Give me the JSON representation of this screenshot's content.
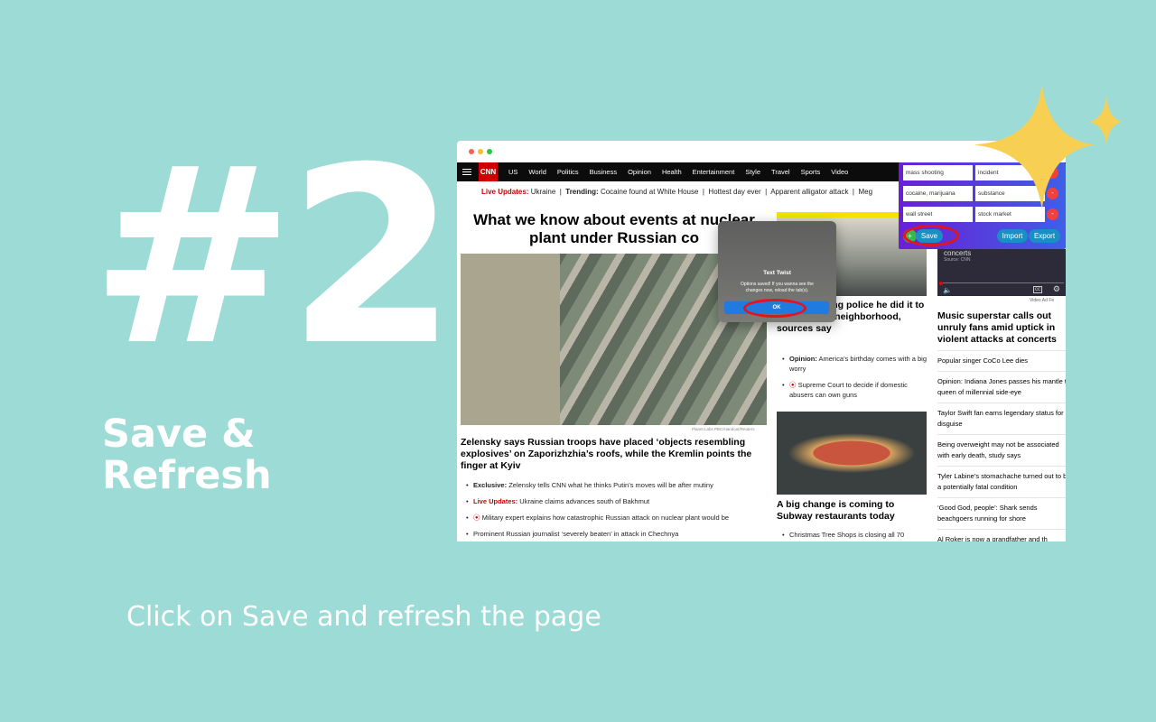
{
  "slide": {
    "number": "#2",
    "title": "Save & Refresh",
    "caption": "Click on Save and refresh the page"
  },
  "colors": {
    "background": "#9ddcd6",
    "cnn_red": "#cc0000",
    "extension_gradient": [
      "#6a1fd6",
      "#3f5fe6"
    ],
    "star": "#f7cf52",
    "highlight_ring": "#e4141b"
  },
  "nav": {
    "logo": "CNN",
    "items": [
      "US",
      "World",
      "Politics",
      "Business",
      "Opinion",
      "Health",
      "Entertainment",
      "Style",
      "Travel",
      "Sports",
      "Video"
    ]
  },
  "trending": {
    "live_label": "Live Updates:",
    "live_text": "Ukraine",
    "trending_label": "Trending:",
    "items": [
      "Cocaine found at White House",
      "Hottest day ever",
      "Apparent alligator attack",
      "Meg"
    ]
  },
  "main": {
    "headline": "What we know about events at nuclear plant under Russian co",
    "image_credit": "Planet Labs PBC/Handout/Reuters",
    "story": "Zelensky says Russian troops have placed ‘objects resembling explosives’ on Zaporizhzhia’s roofs, while the Kremlin points the finger at Kyiv",
    "bullets": [
      {
        "label": "Exclusive:",
        "text": "Zelensky tells CNN what he thinks Putin’s moves will be after mutiny"
      },
      {
        "label": "Live Updates:",
        "text": "Ukraine claims advances south of Bakhmut"
      },
      {
        "text": "Military expert explains how catastrophic Russian attack on nuclear plant would be"
      },
      {
        "text": "Prominent Russian journalist ‘severely beaten’ in attack in Chechnya"
      }
    ]
  },
  "middle": {
    "headline": "mass shooting police he did it to clean up the neighborhood, sources say",
    "bullets": [
      {
        "label": "Opinion:",
        "text": "America’s birthday comes with a big worry"
      },
      {
        "text": "Supreme Court to decide if domestic abusers can own guns"
      }
    ],
    "story2": "A big change is coming to Subway restaurants today",
    "bullets2": [
      "Christmas Tree Shops is closing all 70"
    ]
  },
  "right": {
    "video_title": "concerts",
    "video_source": "Source: CNN",
    "ad_feedback": "Video Ad Fe",
    "headline": "Music superstar calls out unruly fans amid uptick in violent attacks at concerts",
    "list": [
      "Popular singer CoCo Lee dies",
      "Opinion: Indiana Jones passes his mantle to queen of millennial side-eye",
      "Taylor Swift fan earns legendary status for disguise",
      "Being overweight may not be associated with early death, study says",
      "Tyler Labine’s stomachache turned out to be a potentially fatal condition",
      "‘Good God, people’: Shark sends beachgoers running for shore",
      "Al Roker is now a grandfather and th"
    ]
  },
  "extension": {
    "rows": [
      {
        "find": "mass shooting",
        "replace": "incident"
      },
      {
        "find": "cocaine, marijuana",
        "replace": "substance"
      },
      {
        "find": "wall street",
        "replace": "stock market"
      }
    ],
    "remove_label": "-",
    "add_label": "+",
    "save": "Save",
    "import": "Import",
    "export": "Export"
  },
  "dialog": {
    "title": "Text Twist",
    "message": "Options saved! If you wanna see the changes now, reload the tab(s).",
    "ok": "OK"
  }
}
